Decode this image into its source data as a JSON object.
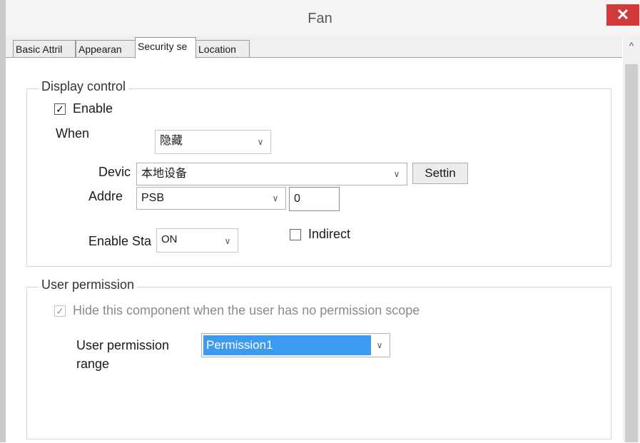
{
  "window": {
    "title": "Fan",
    "close_glyph": "✕"
  },
  "tabs": [
    {
      "label": "Basic Attril"
    },
    {
      "label": "Appearan"
    },
    {
      "label": "Security se"
    },
    {
      "label": "Location"
    }
  ],
  "scrollbar": {
    "up_glyph": "^"
  },
  "display_control": {
    "legend": "Display control",
    "enable_label": "Enable",
    "enable_checked": "✓",
    "when_label": "When",
    "when_value": "隐藏",
    "device_label": "Devic",
    "device_value": "本地设备",
    "settings_label": "Settin",
    "address_label": "Addre",
    "address_type": "PSB",
    "address_value": "0",
    "enable_state_label": "Enable Sta",
    "enable_state_value": "ON",
    "indirect_label": "Indirect",
    "dropdown_glyph": "∨"
  },
  "user_permission": {
    "legend": "User permission",
    "hide_label": "Hide this component when the user has no permission scope",
    "hide_checked": "✓",
    "range_label_line1": "User permission",
    "range_label_line2": "range",
    "range_value": "Permission1"
  },
  "colors": {
    "close_red": "#d13a3a",
    "selection_blue": "#3c9bf0"
  }
}
